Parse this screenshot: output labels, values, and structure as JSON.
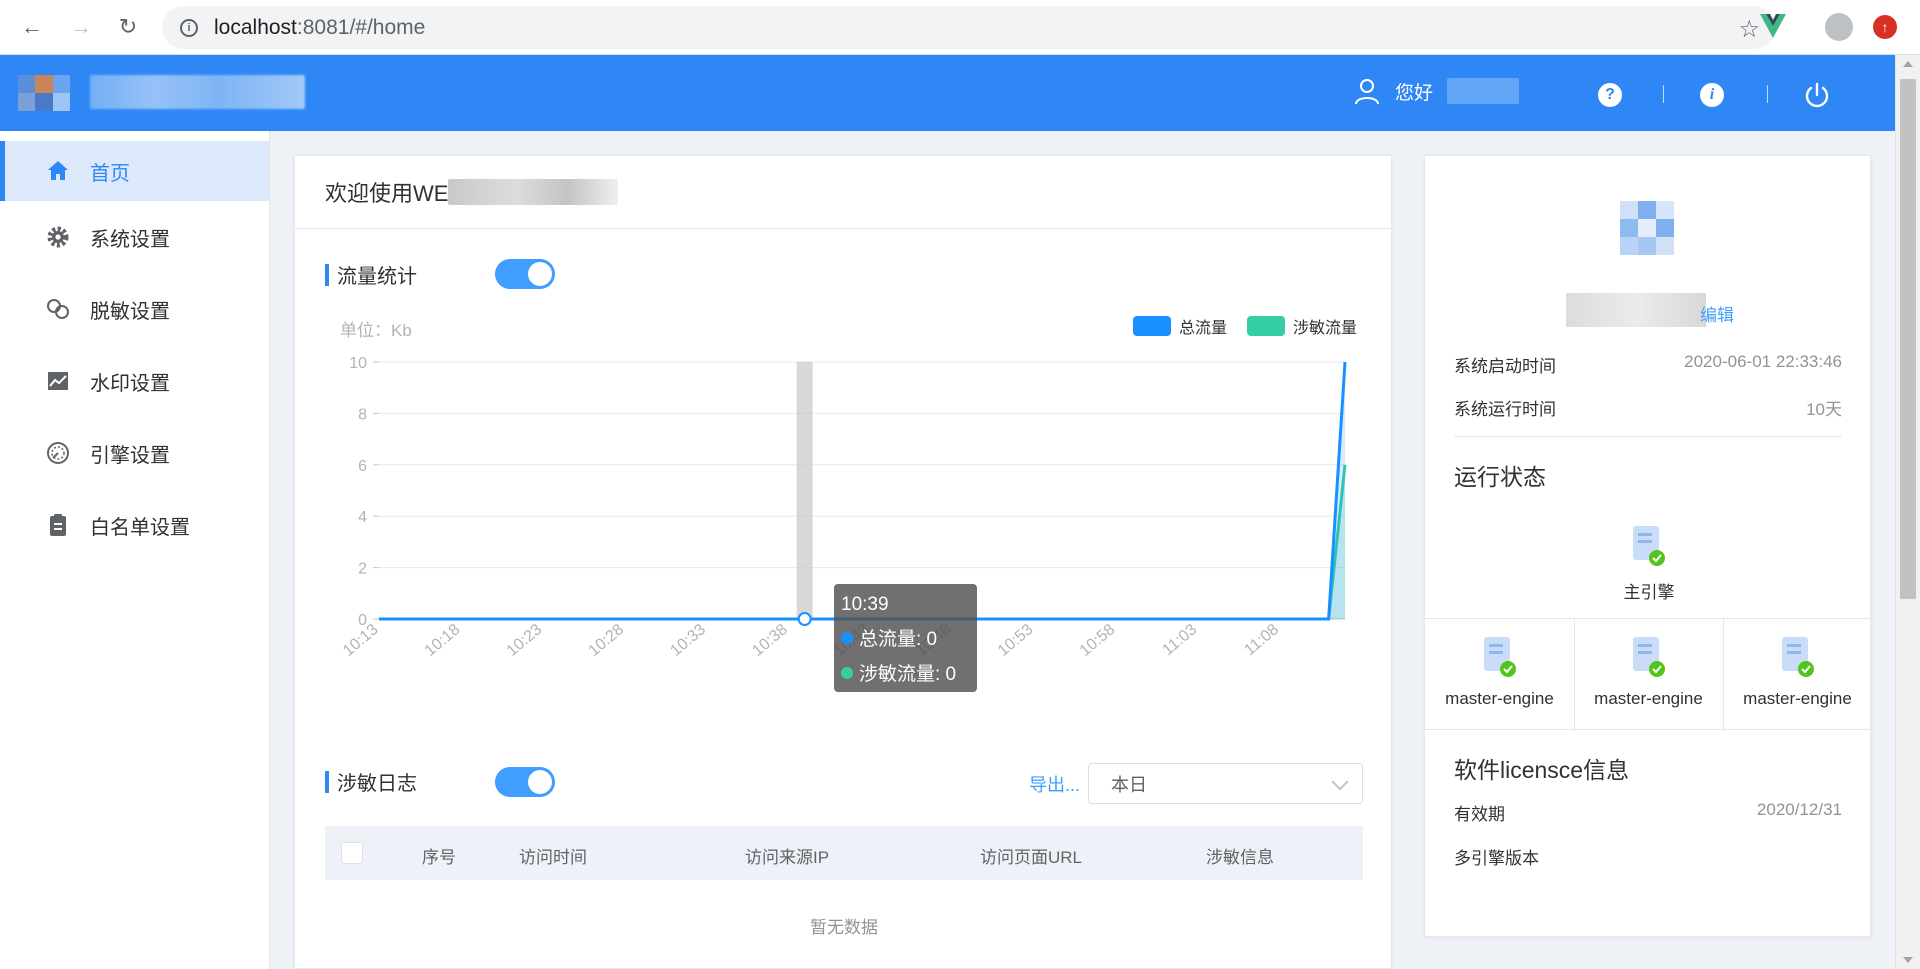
{
  "browser": {
    "url_host": "localhost",
    "url_path": ":8081/#/home"
  },
  "header": {
    "greeting": "您好",
    "help_icon": "question-icon",
    "info_icon": "info-icon",
    "power_icon": "power-icon"
  },
  "sidebar": {
    "items": [
      {
        "label": "首页",
        "icon": "home-icon",
        "active": true
      },
      {
        "label": "系统设置",
        "icon": "gear-icon"
      },
      {
        "label": "脱敏设置",
        "icon": "link-icon"
      },
      {
        "label": "水印设置",
        "icon": "chart-icon"
      },
      {
        "label": "引擎设置",
        "icon": "gauge-icon"
      },
      {
        "label": "白名单设置",
        "icon": "clipboard-icon"
      }
    ]
  },
  "main": {
    "welcome": "欢迎使用WE",
    "traffic": {
      "title": "流量统计",
      "unit": "单位：Kb",
      "legend_total": "总流量",
      "legend_sensitive": "涉敏流量"
    },
    "tooltip": {
      "time": "10:39",
      "total": "总流量: 0",
      "sensitive": "涉敏流量: 0"
    },
    "log": {
      "title": "涉敏日志",
      "export": "导出...",
      "period": "本日",
      "columns": [
        "序号",
        "访问时间",
        "访问来源IP",
        "访问页面URL",
        "涉敏信息"
      ],
      "empty": "暂无数据"
    }
  },
  "right_panel": {
    "edit": "编辑",
    "start_label": "系统启动时间",
    "start_value": "2020-06-01 22:33:46",
    "uptime_label": "系统运行时间",
    "uptime_value": "10天",
    "status_heading": "运行状态",
    "master_engine": "主引擎",
    "engines": [
      "master-engine",
      "master-engine",
      "master-engine"
    ],
    "license_heading": "软件licensce信息",
    "valid_label": "有效期",
    "valid_value": "2020/12/31",
    "edition_label": "多引擎版本"
  },
  "colors": {
    "primary": "#2e87f5",
    "total_series": "#1890ff",
    "sensitive_series": "#36cfa3",
    "success": "#52c41a"
  },
  "chart_data": {
    "type": "line",
    "x": [
      "10:13",
      "10:14",
      "10:15",
      "10:16",
      "10:17",
      "10:18",
      "10:19",
      "10:20",
      "10:21",
      "10:22",
      "10:23",
      "10:24",
      "10:25",
      "10:26",
      "10:27",
      "10:28",
      "10:29",
      "10:30",
      "10:31",
      "10:32",
      "10:33",
      "10:34",
      "10:35",
      "10:36",
      "10:37",
      "10:38",
      "10:39",
      "10:40",
      "10:41",
      "10:42",
      "10:43",
      "10:44",
      "10:45",
      "10:46",
      "10:47",
      "10:48",
      "10:49",
      "10:50",
      "10:51",
      "10:52",
      "10:53",
      "10:54",
      "10:55",
      "10:56",
      "10:57",
      "10:58",
      "10:59",
      "11:00",
      "11:01",
      "11:02",
      "11:03",
      "11:04",
      "11:05",
      "11:06",
      "11:07",
      "11:08",
      "11:09",
      "11:10",
      "11:11",
      "11:12"
    ],
    "tick_labels": [
      "10:13",
      "10:18",
      "10:23",
      "10:28",
      "10:33",
      "10:38",
      "10:43",
      "10:48",
      "10:53",
      "10:58",
      "11:03",
      "11:08"
    ],
    "series": [
      {
        "name": "总流量",
        "values": [
          0,
          0,
          0,
          0,
          0,
          0,
          0,
          0,
          0,
          0,
          0,
          0,
          0,
          0,
          0,
          0,
          0,
          0,
          0,
          0,
          0,
          0,
          0,
          0,
          0,
          0,
          0,
          0,
          0,
          0,
          0,
          0,
          0,
          0,
          0,
          0,
          0,
          0,
          0,
          0,
          0,
          0,
          0,
          0,
          0,
          0,
          0,
          0,
          0,
          0,
          0,
          0,
          0,
          0,
          0,
          0,
          0,
          0,
          0,
          10
        ]
      },
      {
        "name": "涉敏流量",
        "values": [
          0,
          0,
          0,
          0,
          0,
          0,
          0,
          0,
          0,
          0,
          0,
          0,
          0,
          0,
          0,
          0,
          0,
          0,
          0,
          0,
          0,
          0,
          0,
          0,
          0,
          0,
          0,
          0,
          0,
          0,
          0,
          0,
          0,
          0,
          0,
          0,
          0,
          0,
          0,
          0,
          0,
          0,
          0,
          0,
          0,
          0,
          0,
          0,
          0,
          0,
          0,
          0,
          0,
          0,
          0,
          0,
          0,
          0,
          0,
          6
        ]
      }
    ],
    "yticks": [
      0,
      2,
      4,
      6,
      8,
      10
    ],
    "ylim": [
      0,
      10
    ],
    "ylabel": "单位：Kb",
    "highlight_x": "10:39",
    "grid": true,
    "legend": "top-right"
  }
}
